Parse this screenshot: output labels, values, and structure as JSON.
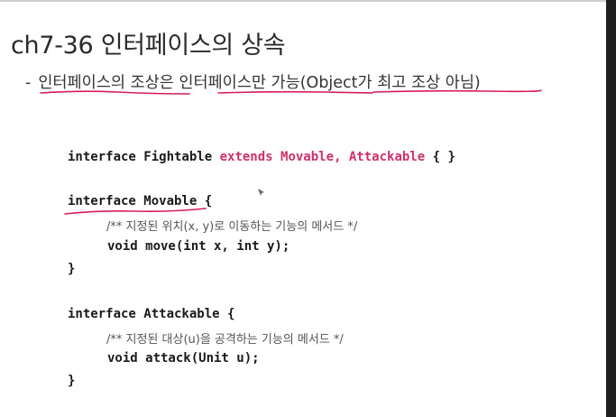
{
  "title": "ch7-36 인터페이스의 상속",
  "bullet": {
    "dash": "-",
    "text": "인터페이스의 조상은 인터페이스만 가능(Object가 최고 조상 아님)"
  },
  "code": {
    "fightable_decl": "interface Fightable",
    "fightable_extends": "extends Movable, Attackable",
    "fightable_body": "{ }",
    "movable_decl": "interface Movable {",
    "movable_comment": "/** 지정된 위치(x, y)로 이동하는 기능의 메서드 */",
    "movable_method": "void move(int x, int y);",
    "movable_close": "}",
    "attackable_decl": "interface Attackable {",
    "attackable_comment": "/** 지정된 대상(u)을 공격하는 기능의 메서드 */",
    "attackable_method": "void attack(Unit u);",
    "attackable_close": "}"
  },
  "colors": {
    "keyword": "#d0306a",
    "underline": "#d81b60",
    "text": "#1a1a1a"
  },
  "icons": {
    "cursor": "pen-cursor-icon"
  }
}
